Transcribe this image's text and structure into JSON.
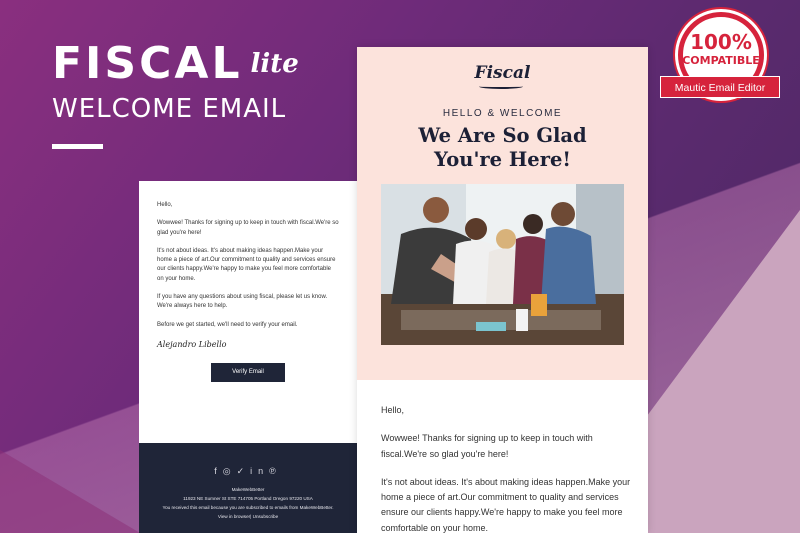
{
  "brand": {
    "name": "FISCAL",
    "edition": "lite",
    "subtitle": "WELCOME EMAIL"
  },
  "badge": {
    "percent": "100%",
    "compatible": "COMPATIBLE",
    "ribbon": "Mautic Email Editor"
  },
  "email_left": {
    "greeting": "Hello,",
    "p1": "Wowwee! Thanks for signing up to keep in touch with fiscal.We're so glad you're here!",
    "p2": "It's not about ideas. It's about making ideas happen.Make your home a piece of art.Our commitment to quality and services ensure our clients happy.We're happy to make you feel more comfortable on your home.",
    "p3": "If you have any questions about using fiscal, please let us know. We're always here to help.",
    "p4": "Before we get started, we'll need to verify your email.",
    "signature": "Alejandro  Libello",
    "verify_button": "Verify Email",
    "footer": {
      "social_icons": [
        "facebook-icon",
        "instagram-icon",
        "twitter-icon",
        "linkedin-icon",
        "pinterest-icon"
      ],
      "company": "MakeWebBetter",
      "address": "11923 NE Sumner St STE 714705 Portland Oregon 97220 USA",
      "notice": "You received this email because you are subscribed to emails from MakeWebBetter.",
      "links": "View in browser| Unsubscribe"
    }
  },
  "email_right": {
    "logo": "Fiscal",
    "hello": "HELLO & WELCOME",
    "title_line1": "We Are So Glad",
    "title_line2": "You're Here!",
    "greeting": "Hello,",
    "p1": "Wowwee! Thanks for signing up to keep in touch with fiscal.We're so glad you're here!",
    "p2": "It's not about ideas. It's about making ideas happen.Make your home a piece of art.Our commitment to quality and services ensure our clients happy.We're happy to make you feel more comfortable on your home."
  },
  "colors": {
    "navy": "#1f2538",
    "peach": "#fce3dc",
    "badge_red": "#d6233c"
  }
}
